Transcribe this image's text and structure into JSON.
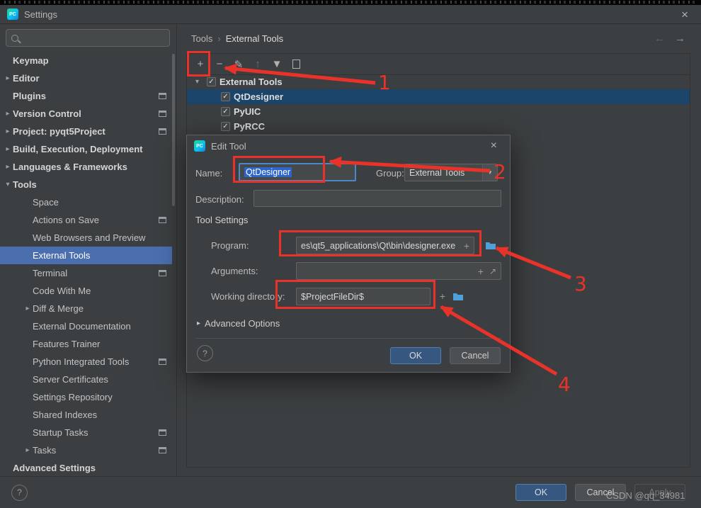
{
  "window": {
    "title": "Settings",
    "app_icon": "PC",
    "close_icon": "×"
  },
  "sidebar": {
    "search": {
      "placeholder": ""
    },
    "items": [
      {
        "label": "Keymap",
        "level": 0,
        "chevron": null,
        "right_icon": false,
        "selected": false
      },
      {
        "label": "Editor",
        "level": 0,
        "chevron": "right",
        "right_icon": false,
        "selected": false
      },
      {
        "label": "Plugins",
        "level": 0,
        "chevron": null,
        "right_icon": true,
        "selected": false
      },
      {
        "label": "Version Control",
        "level": 0,
        "chevron": "right",
        "right_icon": true,
        "selected": false
      },
      {
        "label": "Project: pyqt5Project",
        "level": 0,
        "chevron": "right",
        "right_icon": true,
        "selected": false
      },
      {
        "label": "Build, Execution, Deployment",
        "level": 0,
        "chevron": "right",
        "right_icon": false,
        "selected": false
      },
      {
        "label": "Languages & Frameworks",
        "level": 0,
        "chevron": "right",
        "right_icon": false,
        "selected": false
      },
      {
        "label": "Tools",
        "level": 0,
        "chevron": "down",
        "right_icon": false,
        "selected": false
      },
      {
        "label": "Space",
        "level": 1,
        "chevron": null,
        "right_icon": false,
        "selected": false
      },
      {
        "label": "Actions on Save",
        "level": 1,
        "chevron": null,
        "right_icon": true,
        "selected": false
      },
      {
        "label": "Web Browsers and Preview",
        "level": 1,
        "chevron": null,
        "right_icon": false,
        "selected": false
      },
      {
        "label": "External Tools",
        "level": 1,
        "chevron": null,
        "right_icon": false,
        "selected": true
      },
      {
        "label": "Terminal",
        "level": 1,
        "chevron": null,
        "right_icon": true,
        "selected": false
      },
      {
        "label": "Code With Me",
        "level": 1,
        "chevron": null,
        "right_icon": false,
        "selected": false
      },
      {
        "label": "Diff & Merge",
        "level": 1,
        "chevron": "right",
        "right_icon": false,
        "selected": false
      },
      {
        "label": "External Documentation",
        "level": 1,
        "chevron": null,
        "right_icon": false,
        "selected": false
      },
      {
        "label": "Features Trainer",
        "level": 1,
        "chevron": null,
        "right_icon": false,
        "selected": false
      },
      {
        "label": "Python Integrated Tools",
        "level": 1,
        "chevron": null,
        "right_icon": true,
        "selected": false
      },
      {
        "label": "Server Certificates",
        "level": 1,
        "chevron": null,
        "right_icon": false,
        "selected": false
      },
      {
        "label": "Settings Repository",
        "level": 1,
        "chevron": null,
        "right_icon": false,
        "selected": false
      },
      {
        "label": "Shared Indexes",
        "level": 1,
        "chevron": null,
        "right_icon": false,
        "selected": false
      },
      {
        "label": "Startup Tasks",
        "level": 1,
        "chevron": null,
        "right_icon": true,
        "selected": false
      },
      {
        "label": "Tasks",
        "level": 1,
        "chevron": "right",
        "right_icon": true,
        "selected": false
      },
      {
        "label": "Advanced Settings",
        "level": 0,
        "chevron": null,
        "right_icon": false,
        "selected": false
      }
    ]
  },
  "breadcrumb": {
    "part1": "Tools",
    "separator": "›",
    "part2": "External Tools",
    "back_icon": "←",
    "forward_icon": "→"
  },
  "toolbar": {
    "icons": [
      {
        "name": "add",
        "glyph": "+",
        "dim": false
      },
      {
        "name": "remove",
        "glyph": "−",
        "dim": false
      },
      {
        "name": "edit",
        "glyph": "✎",
        "dim": false
      },
      {
        "name": "move-up",
        "glyph": "↑",
        "dim": true
      },
      {
        "name": "move-down",
        "glyph": "▼",
        "dim": false
      },
      {
        "name": "copy",
        "glyph": "copy",
        "dim": false
      }
    ]
  },
  "tree": {
    "root": {
      "label": "External Tools",
      "checked": true,
      "expanded": true
    },
    "items": [
      {
        "label": "QtDesigner",
        "checked": true,
        "selected": true
      },
      {
        "label": "PyUIC",
        "checked": true,
        "selected": false
      },
      {
        "label": "PyRCC",
        "checked": true,
        "selected": false
      }
    ]
  },
  "dialog": {
    "title": "Edit Tool",
    "close_icon": "×",
    "name_label": "Name:",
    "name_value": "QtDesigner",
    "group_label": "Group:",
    "group_value": "External Tools",
    "description_label": "Description:",
    "description_value": "",
    "section_label": "Tool Settings",
    "program_label": "Program:",
    "program_value": "es\\qt5_applications\\Qt\\bin\\designer.exe",
    "arguments_label": "Arguments:",
    "arguments_value": "",
    "working_dir_label": "Working directory:",
    "working_dir_value": "$ProjectFileDir$",
    "advanced_options_label": "Advanced Options",
    "help_label": "?",
    "ok_label": "OK",
    "cancel_label": "Cancel"
  },
  "footer": {
    "help_label": "?",
    "ok_label": "OK",
    "cancel_label": "Cancel",
    "apply_label": "Apply"
  },
  "annotations": {
    "color": "#e8322a",
    "numbers": [
      "1",
      "2",
      "3",
      "4"
    ]
  },
  "watermark": "CSDN @qq_34981"
}
